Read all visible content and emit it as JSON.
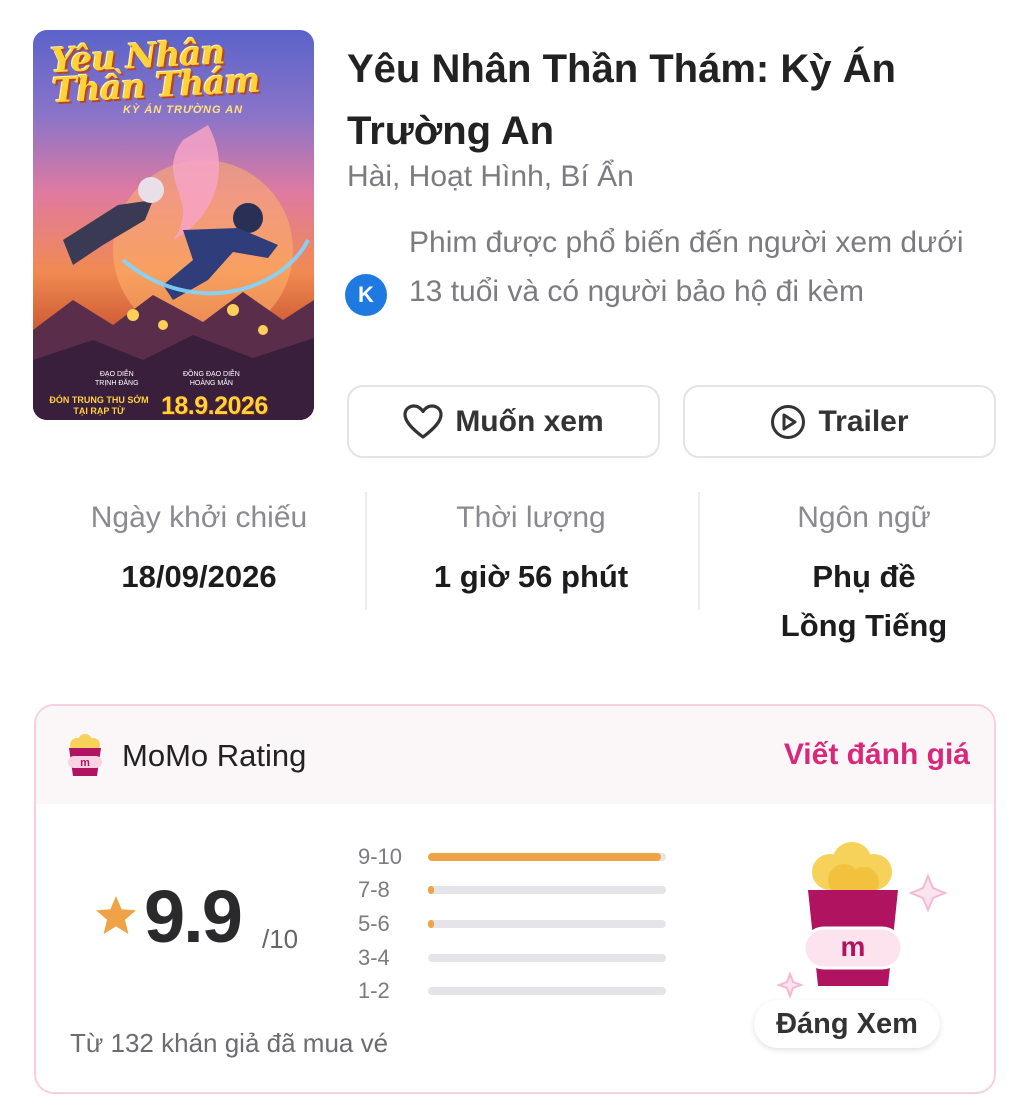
{
  "poster": {
    "title_line1": "Yêu Nhân",
    "title_line2": "Thần Thám",
    "subtitle": "KỲ ÁN TRƯỜNG AN",
    "credit1_role": "ĐẠO DIỄN",
    "credit1_name": "TRỊNH ĐĂNG",
    "credit2_role": "ĐỒNG ĐẠO DIỄN",
    "credit2_name": "HOÀNG MẪN",
    "release_label_line1": "ĐÓN TRUNG THU SỚM",
    "release_label_line2": "TẠI RẠP TỪ",
    "release_date": "18.9.2026"
  },
  "movie": {
    "title": "Yêu Nhân Thần Thám: Kỳ Án Trường An",
    "genres": "Hài, Hoạt Hình, Bí Ẩn",
    "age_badge": "K",
    "age_text": "Phim được phổ biến đến người xem dưới 13 tuổi và có người bảo hộ đi kèm"
  },
  "actions": {
    "want_label": "Muốn xem",
    "want_icon": "heart-icon",
    "trailer_label": "Trailer",
    "trailer_icon": "play-circle-icon"
  },
  "stats": {
    "release_label": "Ngày khởi chiếu",
    "release_value": "18/09/2026",
    "duration_label": "Thời lượng",
    "duration_value": "1 giờ 56 phút",
    "language_label": "Ngôn ngữ",
    "language_value_1": "Phụ đề",
    "language_value_2": "Lồng Tiếng"
  },
  "rating": {
    "title": "MoMo Rating",
    "write_label": "Viết đánh giá",
    "score": "9.9",
    "max": "/10",
    "note": "Từ 132 khán giả đã mua vé",
    "distribution": [
      {
        "label": "9-10",
        "fraction": 0.98
      },
      {
        "label": "7-8",
        "fraction": 0.02
      },
      {
        "label": "5-6",
        "fraction": 0.005
      },
      {
        "label": "3-4",
        "fraction": 0
      },
      {
        "label": "1-2",
        "fraction": 0
      }
    ],
    "badge_label": "Đáng Xem",
    "badge_logo_letter": "m"
  },
  "colors": {
    "accent": "#d8287a",
    "bar_fill": "#f0a247",
    "star": "#f0a247",
    "age_badge": "#1e7ae0"
  }
}
